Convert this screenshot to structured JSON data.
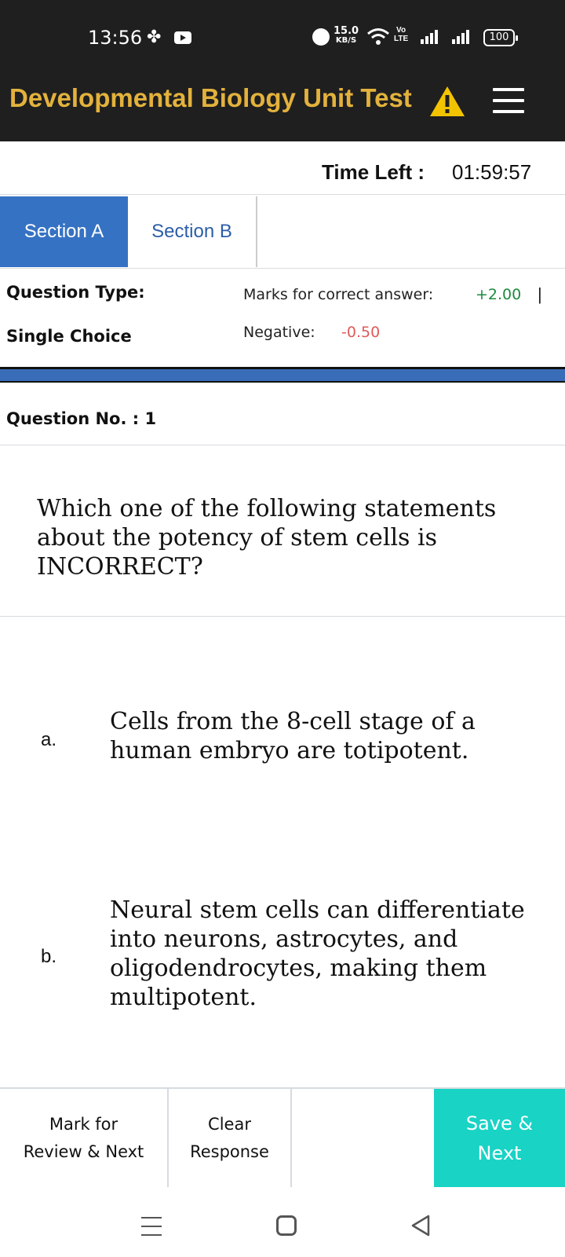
{
  "status_bar": {
    "time": "13:56",
    "net_speed_value": "15.0",
    "net_speed_unit": "KB/S",
    "volte_top": "Vo",
    "volte_bottom": "LTE",
    "battery": "100"
  },
  "header": {
    "title": "Developmental Biology Unit Test",
    "title_color": "#e3b23c",
    "warning_icon": "warning-triangle-icon",
    "menu_icon": "hamburger-menu-icon"
  },
  "timer": {
    "label": "Time Left :",
    "value": "01:59:57"
  },
  "sections": [
    {
      "label": "Section A",
      "active": true
    },
    {
      "label": "Section B",
      "active": false
    }
  ],
  "question_meta": {
    "type_label": "Question Type:",
    "type_value": "Single Choice",
    "marks_label": "Marks for correct answer:",
    "marks_value": "+2.00",
    "separator": "|",
    "negative_label": "Negative:",
    "negative_value": "-0.50"
  },
  "question": {
    "number_label": "Question No. : 1",
    "text": "Which one of the following statements about the potency of stem cells is INCORRECT?"
  },
  "options": [
    {
      "letter": "a.",
      "text": "Cells from the 8-cell stage of a human embryo are totipotent."
    },
    {
      "letter": "b.",
      "text": "Neural stem cells can differentiate into neurons, astrocytes, and oligodendrocytes, making them multipotent."
    }
  ],
  "actions": {
    "review_line1": "Mark for",
    "review_line2": "Review & Next",
    "clear_line1": "Clear",
    "clear_line2": "Response",
    "save_line1": "Save &",
    "save_line2": "Next",
    "save_color": "#19d3c5"
  },
  "colors": {
    "header_bg": "#1f1f1f",
    "active_tab": "#3672c3",
    "positive": "#1d8a3e",
    "negative": "#e05a5a"
  }
}
